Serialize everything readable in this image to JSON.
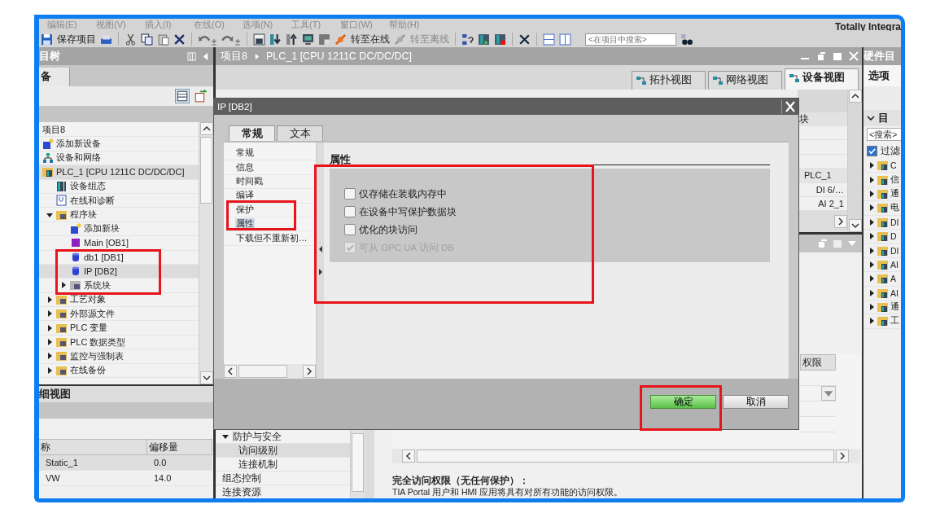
{
  "app_title": "Totally Integra",
  "menu": [
    "编辑(E)",
    "视图(V)",
    "插入(I)",
    "在线(O)",
    "选项(N)",
    "工具(T)",
    "窗口(W)",
    "帮助(H)"
  ],
  "toolbar": {
    "save": "保存项目",
    "go_online": "转至在线",
    "go_offline": "转至离线",
    "search": {
      "placeholder": "<在项目中搜索>"
    }
  },
  "project_tree": {
    "title": "目树",
    "tab": "备",
    "items": [
      {
        "label": "项目8",
        "selected": false,
        "children": [
          {
            "label": "添加新设备",
            "kind": "add",
            "selected": false
          },
          {
            "label": "设备和网络",
            "kind": "network",
            "selected": false
          },
          {
            "label": "PLC_1 [CPU 1211C DC/DC/DC]",
            "kind": "plc",
            "selected": true,
            "children": [
              {
                "label": "设备组态",
                "kind": "config",
                "selected": false
              },
              {
                "label": "在线和诊断",
                "kind": "diag",
                "selected": false
              },
              {
                "label": "程序块",
                "kind": "folder",
                "selected": false,
                "expanded": true,
                "children": [
                  {
                    "label": "添加新块",
                    "kind": "add",
                    "selected": false
                  },
                  {
                    "label": "Main [OB1]",
                    "kind": "ob",
                    "selected": false
                  },
                  {
                    "label": "db1 [DB1]",
                    "kind": "db",
                    "selected": false
                  },
                  {
                    "label": "IP [DB2]",
                    "kind": "db",
                    "selected": true
                  },
                  {
                    "label": "系统块",
                    "kind": "sysfolder",
                    "selected": false,
                    "expanded": false
                  }
                ]
              },
              {
                "label": "工艺对象",
                "kind": "folder",
                "selected": false,
                "expanded": false
              },
              {
                "label": "外部源文件",
                "kind": "folder",
                "selected": false,
                "expanded": false
              },
              {
                "label": "PLC 变量",
                "kind": "folder",
                "selected": false,
                "expanded": false
              },
              {
                "label": "PLC 数据类型",
                "kind": "folder",
                "selected": false,
                "expanded": false
              },
              {
                "label": "监控与强制表",
                "kind": "folder",
                "selected": false,
                "expanded": false
              },
              {
                "label": "在线备份",
                "kind": "folder",
                "selected": false,
                "expanded": false
              }
            ]
          }
        ]
      }
    ]
  },
  "details_view": {
    "title": "细视图",
    "columns": [
      "称",
      "偏移量"
    ],
    "rows": [
      [
        "Static_1",
        "0.0"
      ],
      [
        "VW",
        "14.0"
      ]
    ]
  },
  "editor": {
    "breadcrumb": [
      "项目8",
      "PLC_1 [CPU 1211C DC/DC/DC]"
    ],
    "view_tabs": [
      {
        "label": "拓扑视图",
        "selected": false
      },
      {
        "label": "网络视图",
        "selected": false
      },
      {
        "label": "设备视图",
        "selected": true
      }
    ],
    "overview": {
      "column": "块",
      "rows": [
        "PLC_1",
        "DI 6/…",
        "AI 2_1"
      ]
    }
  },
  "inspector": {
    "nav": [
      {
        "label": "防护与安全",
        "expanded": true,
        "selected": false,
        "children": [
          {
            "label": "访问级别",
            "selected": true
          },
          {
            "label": "连接机制",
            "selected": false
          }
        ]
      },
      {
        "label": "组态控制",
        "selected": false
      },
      {
        "label": "连接资源",
        "selected": false
      }
    ],
    "table_column": "权限",
    "access_title": "完全访问权限（无任何保护）：",
    "access_text": "TIA Portal 用户和 HMI 应用将具有对所有功能的访问权限。"
  },
  "catalog": {
    "title": "硬件目",
    "options": "选项",
    "section": "目",
    "search": {
      "placeholder": "<搜索>"
    },
    "filter": {
      "label": "过滤",
      "checked": true
    },
    "folders": [
      "C",
      "信",
      "通",
      "电",
      "DI",
      "D",
      "DI",
      "AI",
      "A",
      "AI",
      "通",
      "工"
    ]
  },
  "dialog": {
    "title": "IP [DB2]",
    "tabs": [
      {
        "label": "常规",
        "selected": true
      },
      {
        "label": "文本",
        "selected": false
      }
    ],
    "nav": [
      {
        "label": "常规",
        "selected": false
      },
      {
        "label": "信息",
        "selected": false
      },
      {
        "label": "时间戳",
        "selected": false
      },
      {
        "label": "编译",
        "selected": false
      },
      {
        "label": "保护",
        "selected": false
      },
      {
        "label": "属性",
        "selected": true
      },
      {
        "label": "下载但不重新初…",
        "selected": false
      }
    ],
    "section": "属性",
    "properties": [
      {
        "label": "仅存储在装载内存中",
        "checked": false,
        "disabled": false
      },
      {
        "label": "在设备中写保护数据块",
        "checked": false,
        "disabled": false
      },
      {
        "label": "优化的块访问",
        "checked": false,
        "disabled": false
      },
      {
        "label": "可从 OPC UA 访问 DB",
        "checked": true,
        "disabled": true
      }
    ],
    "buttons": [
      {
        "label": "确定",
        "kind": "primary"
      },
      {
        "label": "取消",
        "kind": "normal"
      }
    ]
  }
}
